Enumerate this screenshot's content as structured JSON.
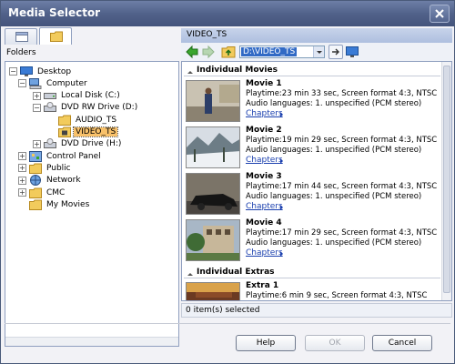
{
  "window": {
    "title": "Media Selector"
  },
  "left": {
    "folders_label": "Folders",
    "tree": [
      {
        "label": "Desktop",
        "icon": "desktop-icon",
        "expander": "-"
      },
      {
        "label": "Computer",
        "icon": "computer-icon",
        "expander": "-"
      },
      {
        "label": "Local Disk (C:)",
        "icon": "hard-disk-icon",
        "expander": "+"
      },
      {
        "label": "DVD RW Drive (D:)",
        "icon": "dvd-drive-icon",
        "expander": "-"
      },
      {
        "label": "AUDIO_TS",
        "icon": "folder-icon",
        "expander": ""
      },
      {
        "label": "VIDEO_TS",
        "icon": "video-folder-icon",
        "expander": "",
        "selected": true
      },
      {
        "label": "DVD Drive (H:)",
        "icon": "dvd-drive-icon",
        "expander": "+"
      },
      {
        "label": "Control Panel",
        "icon": "control-panel-icon",
        "expander": "+"
      },
      {
        "label": "Public",
        "icon": "folder-icon",
        "expander": "+"
      },
      {
        "label": "Network",
        "icon": "network-icon",
        "expander": "+"
      },
      {
        "label": "CMC",
        "icon": "folder-icon",
        "expander": "+"
      },
      {
        "label": "My Movies",
        "icon": "folder-icon",
        "expander": ""
      }
    ]
  },
  "right": {
    "header": "VIDEO_TS",
    "path_value": "D:\\VIDEO_TS",
    "groups": {
      "movies": "Individual Movies",
      "extras": "Individual Extras"
    },
    "movies": [
      {
        "title": "Movie 1",
        "line1": "Playtime:23 min 33 sec, Screen format 4:3, NTSC",
        "line2": "Audio languages: 1. unspecified (PCM stereo)",
        "chapters": "Chapters"
      },
      {
        "title": "Movie 2",
        "line1": "Playtime:19 min 29 sec, Screen format 4:3, NTSC",
        "line2": "Audio languages: 1. unspecified (PCM stereo)",
        "chapters": "Chapters"
      },
      {
        "title": "Movie 3",
        "line1": "Playtime:17 min 44 sec, Screen format 4:3, NTSC",
        "line2": "Audio languages: 1. unspecified (PCM stereo)",
        "chapters": "Chapters"
      },
      {
        "title": "Movie 4",
        "line1": "Playtime:17 min 29 sec, Screen format 4:3, NTSC",
        "line2": "Audio languages: 1. unspecified (PCM stereo)",
        "chapters": "Chapters"
      }
    ],
    "extras": [
      {
        "title": "Extra 1",
        "line1": "Playtime:6 min 9 sec, Screen format 4:3, NTSC"
      }
    ],
    "status": "0 item(s) selected"
  },
  "buttons": {
    "help": "Help",
    "ok": "OK",
    "cancel": "Cancel"
  },
  "colors": {
    "titlebar": "#51628a",
    "selection": "#316ac5",
    "tree_selected": "#f8c16a",
    "link": "#1a3fae"
  }
}
